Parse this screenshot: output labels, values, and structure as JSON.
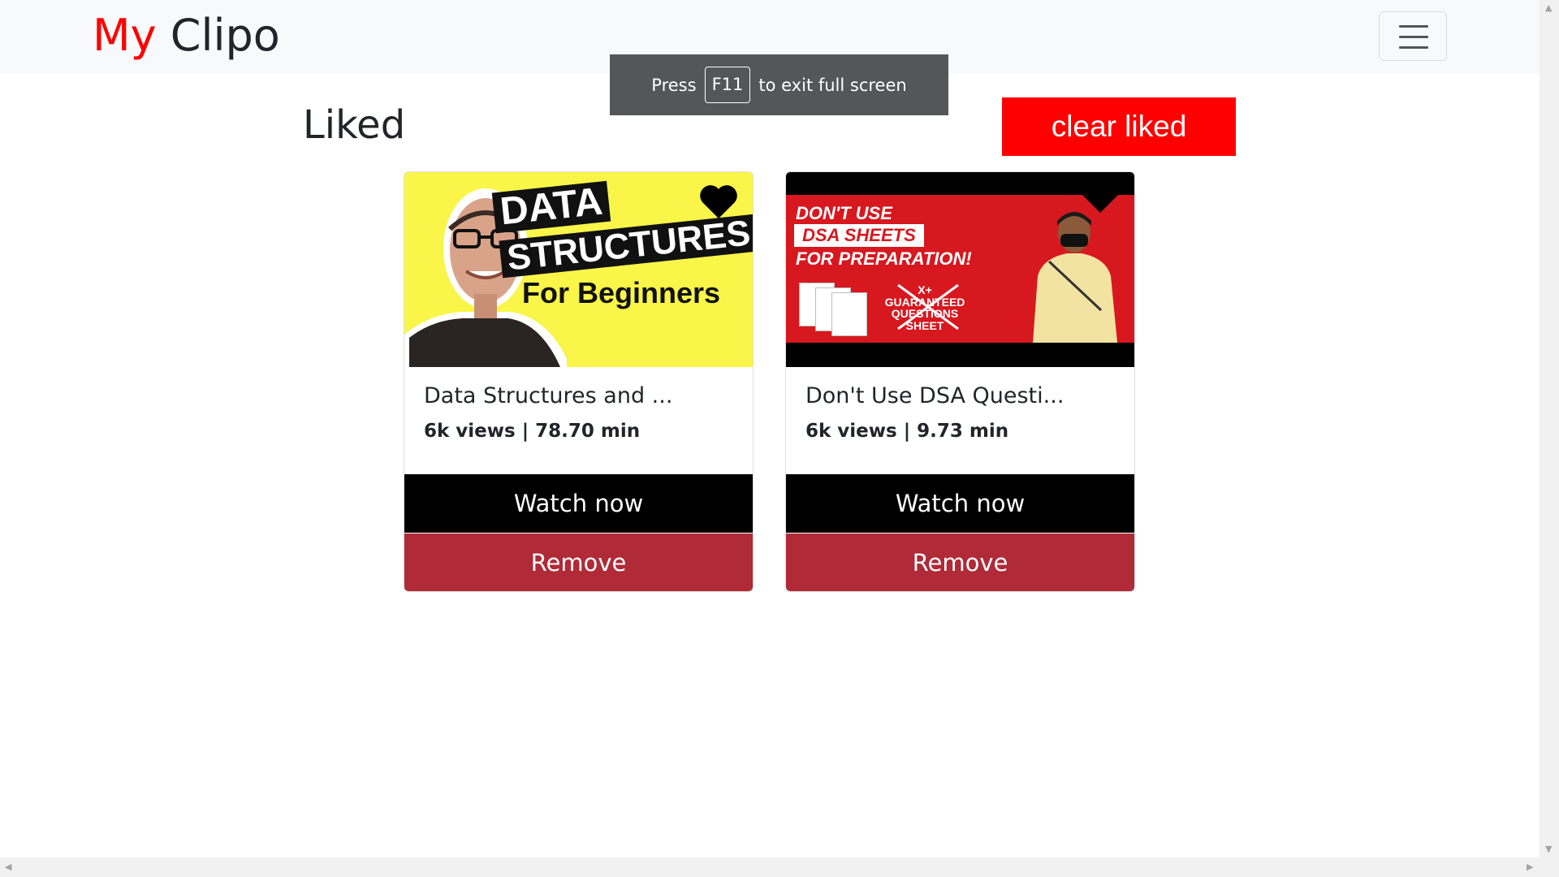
{
  "brand": {
    "part1": "My",
    "part2": "Clipo"
  },
  "fullscreen_notice": {
    "before": "Press",
    "key": "F11",
    "after": "to exit full screen"
  },
  "page": {
    "title": "Liked",
    "clear_label": "clear liked"
  },
  "cards": [
    {
      "title": "Data Structures and ...",
      "meta": "6k views | 78.70 min",
      "watch_label": "Watch now",
      "remove_label": "Remove",
      "thumbnail": {
        "line1": "DATA",
        "line2": "STRUCTURES",
        "line3": "For Beginners",
        "bg": "#f9f549"
      }
    },
    {
      "title": "Don't Use DSA Questi...",
      "meta": "6k views | 9.73 min",
      "watch_label": "Watch now",
      "remove_label": "Remove",
      "thumbnail": {
        "line1": "DON'T USE",
        "line2": "DSA SHEETS",
        "line3": "FOR PREPARATION!",
        "badge1": "X+",
        "badge2": "GUARANTEED",
        "badge3": "QUESTIONS",
        "badge4": "SHEET",
        "bg": "#d7181f"
      }
    }
  ],
  "colors": {
    "brand_red": "#ff0000",
    "watch_bg": "#000000",
    "remove_bg": "#b02a37",
    "clear_bg": "#ff0000",
    "navbar_bg": "#f8f9fa"
  },
  "icons": [
    "hamburger-menu-icon",
    "heart-icon"
  ]
}
